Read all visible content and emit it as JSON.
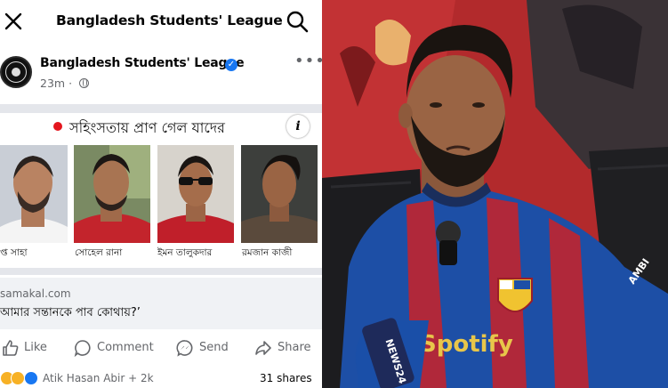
{
  "fb": {
    "topbar": {
      "title": "Bangladesh Students' League",
      "close_icon": "close-icon",
      "search_icon": "search-icon"
    },
    "post": {
      "author": "Bangladesh Students' League",
      "verified_icon": "verified-badge-icon",
      "time": "23m",
      "audience_icon": "globe-icon",
      "more": "•••"
    },
    "card": {
      "heading": "সহিংসতায় প্রাণ গেল যাদের",
      "info": "i",
      "captions": [
        "প্ত সাহা",
        "সোহেল রানা",
        "ইমন তালুকদার",
        "রমজান কাজী"
      ]
    },
    "link": {
      "domain": "samakal.com",
      "headline": "আমার সন্তানকে পাব কোথায়?’"
    },
    "actions": [
      {
        "label": "Like",
        "icon": "like-icon"
      },
      {
        "label": "Comment",
        "icon": "comment-icon"
      },
      {
        "label": "Send",
        "icon": "messenger-icon"
      },
      {
        "label": "Share",
        "icon": "share-icon"
      }
    ],
    "reactions": {
      "names": "Atik Hasan Abir + 2k",
      "shares": "31 shares",
      "icons": [
        "sad-react-icon",
        "haha-react-icon",
        "like-react-icon"
      ]
    }
  },
  "video": {
    "mic_brand": "NEWS24",
    "jersey_sponsor": "Spotify",
    "sleeve_text": "AMBI"
  },
  "colors": {
    "fb_blue": "#1877f2",
    "gray_text": "#65676b",
    "red_dot": "#e4161e",
    "jersey_blue": "#1d4fa6",
    "jersey_red": "#b0283a"
  }
}
